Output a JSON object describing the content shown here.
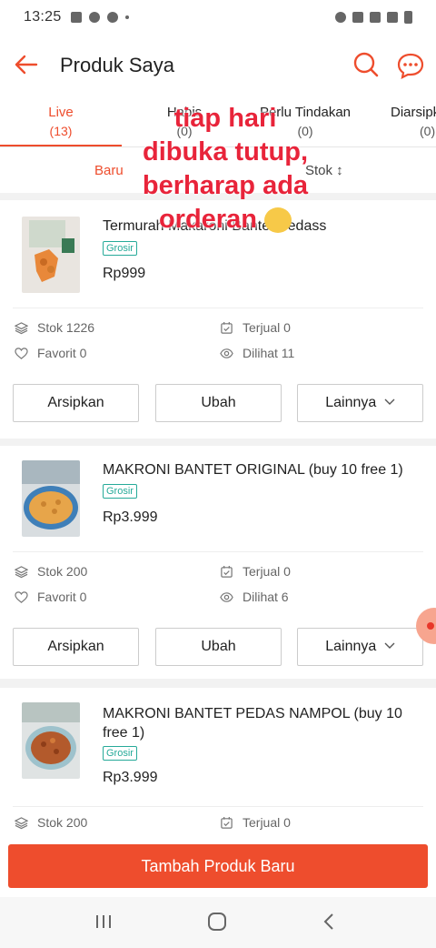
{
  "status_bar": {
    "time": "13:25"
  },
  "header": {
    "title": "Produk Saya"
  },
  "tabs": [
    {
      "label": "Live",
      "count": "(13)"
    },
    {
      "label": "Habis",
      "count": "(0)"
    },
    {
      "label": "Perlu Tindakan",
      "count": "(0)"
    },
    {
      "label": "Diarsipkan",
      "count": "(0)"
    }
  ],
  "sort": {
    "newest": "Baru",
    "stock": "Stok ↕"
  },
  "overlay_text": {
    "line1": "tiap hari",
    "line2": "dibuka tutup,",
    "line3": "berharap ada",
    "line4": "orderan"
  },
  "products": [
    {
      "name": "Termurah Makaroni Bantet Pedass",
      "badge": "Grosir",
      "price": "Rp999",
      "stock": "Stok 1226",
      "sold": "Terjual 0",
      "favorite": "Favorit 0",
      "views": "Dilihat 11",
      "btn_archive": "Arsipkan",
      "btn_edit": "Ubah",
      "btn_more": "Lainnya"
    },
    {
      "name": "MAKRONI BANTET ORIGINAL (buy 10 free 1)",
      "badge": "Grosir",
      "price": "Rp3.999",
      "stock": "Stok 200",
      "sold": "Terjual 0",
      "favorite": "Favorit 0",
      "views": "Dilihat 6",
      "btn_archive": "Arsipkan",
      "btn_edit": "Ubah",
      "btn_more": "Lainnya"
    },
    {
      "name": "MAKRONI BANTET PEDAS NAMPOL (buy 10 free 1)",
      "badge": "Grosir",
      "price": "Rp3.999",
      "stock": "Stok 200",
      "sold": "Terjual 0"
    }
  ],
  "bottom": {
    "add_button": "Tambah Produk Baru"
  },
  "colors": {
    "accent": "#ee4d2d",
    "overlay": "#e8243a",
    "badge": "#26aa99"
  }
}
